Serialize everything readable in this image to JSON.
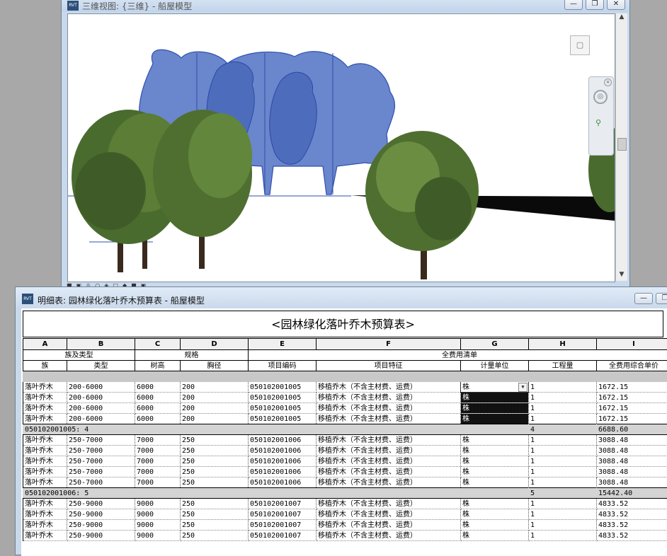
{
  "view3d": {
    "title": "三维视图: {三维} - 船屋模型",
    "icon_text": "RVT",
    "window_buttons": [
      "minimize-icon",
      "restore-icon",
      "close-icon"
    ],
    "colors": {
      "tree_silhouette": "#5f7fc6",
      "tree_outline": "#2f4fa8",
      "foliage": "#4a6b2e",
      "trunk": "#3a2a1e"
    }
  },
  "schedule": {
    "window_title": "明细表: 园林绿化落叶乔木预算表 - 船屋模型",
    "icon_text": "RVT",
    "sheet_title": "<园林绿化落叶乔木预算表>",
    "column_letters": [
      "A",
      "B",
      "C",
      "D",
      "E",
      "F",
      "G",
      "H",
      "I"
    ],
    "group_headers": {
      "family_type": "族及类型",
      "spec": "规格",
      "bill": "全费用清单"
    },
    "column_headers": [
      "族",
      "类型",
      "树高",
      "胸径",
      "项目编码",
      "项目特征",
      "计量单位",
      "工程量",
      "全费用综合单价"
    ],
    "groups": [
      {
        "label": "050102001005: 4",
        "qty_total": "4",
        "price_total": "6688.60",
        "rows": [
          [
            "落叶乔木",
            "200-6000",
            "6000",
            "200",
            "050102001005",
            "移植乔木（不含主材费、运费）",
            "株",
            "1",
            "1672.15"
          ],
          [
            "落叶乔木",
            "200-6000",
            "6000",
            "200",
            "050102001005",
            "移植乔木（不含主材费、运费）",
            "株",
            "1",
            "1672.15"
          ],
          [
            "落叶乔木",
            "200-6000",
            "6000",
            "200",
            "050102001005",
            "移植乔木（不含主材费、运费）",
            "株",
            "1",
            "1672.15"
          ],
          [
            "落叶乔木",
            "200-6000",
            "6000",
            "200",
            "050102001005",
            "移植乔木（不含主材费、运费）",
            "株",
            "1",
            "1672.15"
          ]
        ]
      },
      {
        "label": "050102001006: 5",
        "qty_total": "5",
        "price_total": "15442.40",
        "rows": [
          [
            "落叶乔木",
            "250-7000",
            "7000",
            "250",
            "050102001006",
            "移植乔木（不含主材费、运费）",
            "株",
            "1",
            "3088.48"
          ],
          [
            "落叶乔木",
            "250-7000",
            "7000",
            "250",
            "050102001006",
            "移植乔木（不含主材费、运费）",
            "株",
            "1",
            "3088.48"
          ],
          [
            "落叶乔木",
            "250-7000",
            "7000",
            "250",
            "050102001006",
            "移植乔木（不含主材费、运费）",
            "株",
            "1",
            "3088.48"
          ],
          [
            "落叶乔木",
            "250-7000",
            "7000",
            "250",
            "050102001006",
            "移植乔木（不含主材费、运费）",
            "株",
            "1",
            "3088.48"
          ],
          [
            "落叶乔木",
            "250-7000",
            "7000",
            "250",
            "050102001006",
            "移植乔木（不含主材费、运费）",
            "株",
            "1",
            "3088.48"
          ]
        ]
      },
      {
        "rows": [
          [
            "落叶乔木",
            "250-9000",
            "9000",
            "250",
            "050102001007",
            "移植乔木（不含主材费、运费）",
            "株",
            "1",
            "4833.52"
          ],
          [
            "落叶乔木",
            "250-9000",
            "9000",
            "250",
            "050102001007",
            "移植乔木（不含主材费、运费）",
            "株",
            "1",
            "4833.52"
          ],
          [
            "落叶乔木",
            "250-9000",
            "9000",
            "250",
            "050102001007",
            "移植乔木（不含主材费、运费）",
            "株",
            "1",
            "4833.52"
          ],
          [
            "落叶乔木",
            "250-9000",
            "9000",
            "250",
            "050102001007",
            "移植乔木（不含主材费、运费）",
            "株",
            "1",
            "4833.52"
          ]
        ]
      }
    ],
    "selection": {
      "color": "#111111"
    }
  }
}
